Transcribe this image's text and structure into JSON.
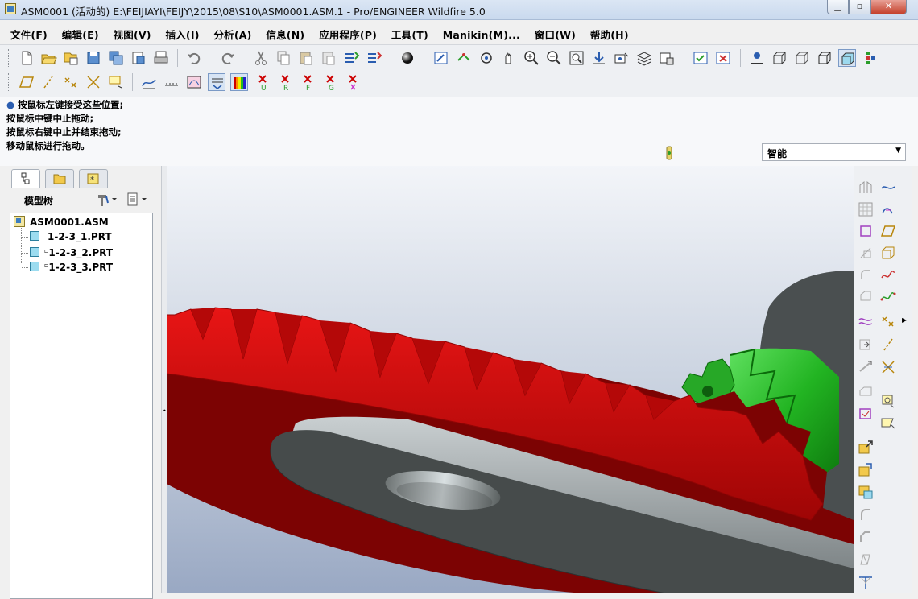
{
  "window": {
    "title": "ASM0001 (活动的) E:\\FEIJIAYI\\FEIJY\\2015\\08\\S10\\ASM0001.ASM.1 - Pro/ENGINEER Wildfire 5.0"
  },
  "menubar": {
    "items": [
      {
        "label": "文件(F)"
      },
      {
        "label": "编辑(E)"
      },
      {
        "label": "视图(V)"
      },
      {
        "label": "插入(I)"
      },
      {
        "label": "分析(A)"
      },
      {
        "label": "信息(N)"
      },
      {
        "label": "应用程序(P)"
      },
      {
        "label": "工具(T)"
      },
      {
        "label": "Manikin(M)..."
      },
      {
        "label": "窗口(W)"
      },
      {
        "label": "帮助(H)"
      }
    ]
  },
  "messages": [
    "按鼠标左键接受这些位置;",
    "按鼠标中键中止拖动;",
    "按鼠标右键中止并结束拖动;",
    "移动鼠标进行拖动。"
  ],
  "filter": {
    "value": "智能"
  },
  "model_tree": {
    "header": "模型树",
    "root": "ASM0001.ASM",
    "items": [
      {
        "label": "1-2-3_1.PRT"
      },
      {
        "label": "1-2-3_2.PRT"
      },
      {
        "label": "1-2-3_3.PRT"
      }
    ]
  },
  "colors": {
    "gear_red": "#cc0000",
    "gear_green": "#2fb52f",
    "plate_gray": "#454a4a",
    "viewport_bg_top": "#f3f5f9",
    "viewport_bg_bottom": "#99a8c3"
  }
}
